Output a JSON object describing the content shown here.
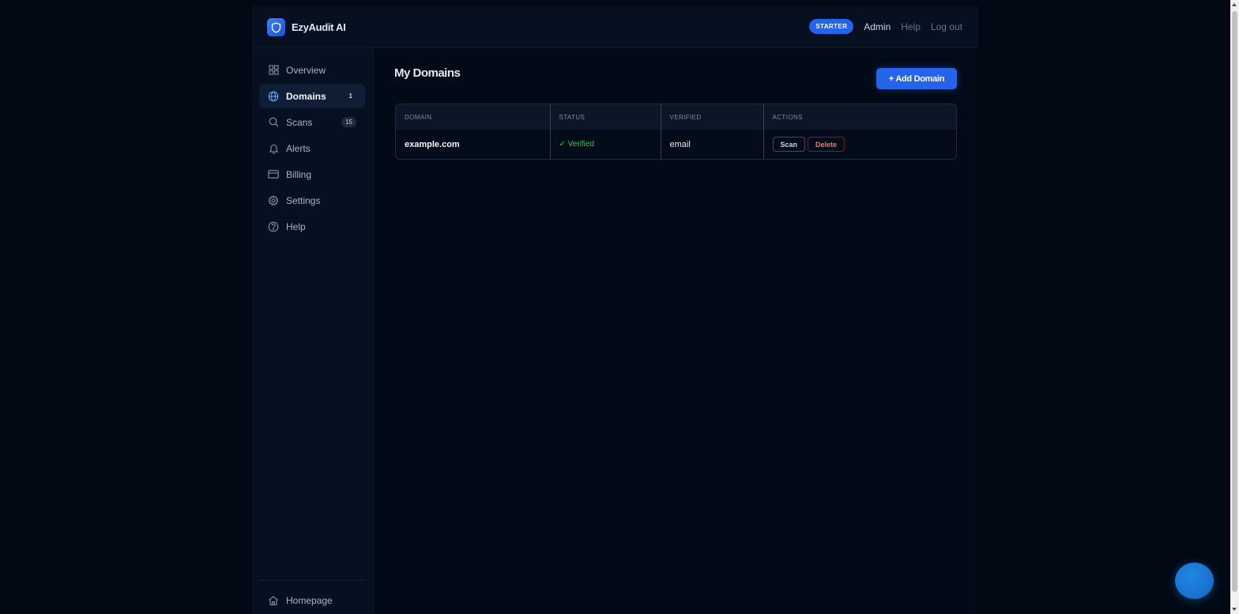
{
  "app": {
    "name": "EzyAudit AI"
  },
  "header": {
    "plan_badge": "STARTER",
    "admin_link": "Admin",
    "help_link": "Help",
    "logout_link": "Log out"
  },
  "sidebar": {
    "items": [
      {
        "label": "Overview",
        "icon": "grid-icon"
      },
      {
        "label": "Domains",
        "icon": "globe-icon",
        "count": "1",
        "active": true
      },
      {
        "label": "Scans",
        "icon": "search-icon",
        "count": "15"
      },
      {
        "label": "Alerts",
        "icon": "bell-icon"
      },
      {
        "label": "Billing",
        "icon": "credit-card-icon"
      },
      {
        "label": "Settings",
        "icon": "gear-icon"
      },
      {
        "label": "Help",
        "icon": "help-circle-icon"
      }
    ],
    "bottom": {
      "label": "Homepage",
      "icon": "home-icon"
    }
  },
  "main": {
    "title": "My Domains",
    "add_button": "+ Add Domain",
    "table": {
      "headers": [
        "DOMAIN",
        "STATUS",
        "VERIFIED",
        "ACTIONS"
      ],
      "rows": [
        {
          "domain": "example.com",
          "status": "✓ Verified",
          "verified": "email",
          "actions": {
            "scan": "Scan",
            "delete": "Delete"
          }
        }
      ]
    }
  },
  "colors": {
    "accent": "#2563eb",
    "success": "#22c55e",
    "danger": "#f87171",
    "background": "#020814"
  }
}
